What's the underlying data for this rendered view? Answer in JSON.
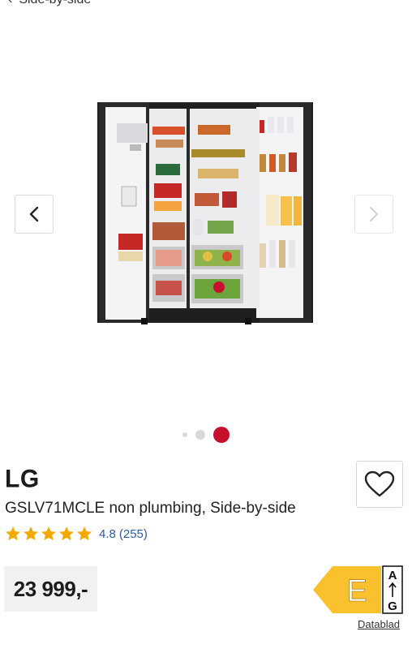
{
  "breadcrumb": {
    "label": "Side-by-side"
  },
  "gallery": {
    "image_alt": "LG side-by-side fridge with doors open",
    "active_index": 2,
    "dot_count": 3
  },
  "product": {
    "brand": "LG",
    "title": "GSLV71MCLE non plumbing, Side-by-side",
    "rating": {
      "score": "4.8",
      "count": "(255)",
      "stars": 5
    },
    "price": "23 999,-"
  },
  "energy_label": {
    "class": "E",
    "scale_top": "A",
    "scale_bottom": "G",
    "link_label": "Datablad"
  },
  "colors": {
    "accent_red": "#c8102e",
    "star": "#f5a800",
    "energy_yellow": "#fbc02d",
    "link_blue": "#2b5aa8"
  }
}
